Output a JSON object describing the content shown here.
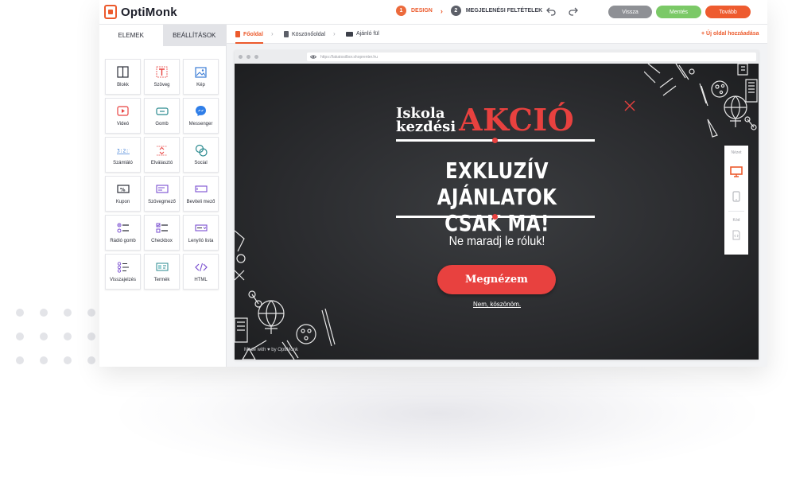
{
  "app": {
    "logo_text": "OptiMonk",
    "brand_color": "#ec5a2c"
  },
  "steps": [
    {
      "num": "1",
      "label": "DESIGN",
      "active": true
    },
    {
      "num": "2",
      "label": "MEGJELENÉSI FELTÉTELEK",
      "active": false
    }
  ],
  "toolbar": {
    "back_label": "Vissza",
    "save_label": "Mentés",
    "next_label": "Tovább",
    "undo_icon": "undo-icon",
    "redo_icon": "redo-icon"
  },
  "sidebar": {
    "tabs": [
      {
        "label": "ELEMEK",
        "active": true
      },
      {
        "label": "BEÁLLÍTÁSOK",
        "active": false
      }
    ],
    "elements": [
      {
        "label": "Blokk",
        "icon": "block-icon"
      },
      {
        "label": "Szöveg",
        "icon": "text-icon"
      },
      {
        "label": "Kép",
        "icon": "image-icon"
      },
      {
        "label": "Videó",
        "icon": "video-icon"
      },
      {
        "label": "Gomb",
        "icon": "button-icon"
      },
      {
        "label": "Messenger",
        "icon": "messenger-icon"
      },
      {
        "label": "Számláló",
        "icon": "counter-icon"
      },
      {
        "label": "Elválasztó",
        "icon": "divider-icon"
      },
      {
        "label": "Social",
        "icon": "social-icon"
      },
      {
        "label": "Kupon",
        "icon": "coupon-icon"
      },
      {
        "label": "Szövegmező",
        "icon": "textarea-icon"
      },
      {
        "label": "Beviteli mező",
        "icon": "input-field-icon"
      },
      {
        "label": "Rádió gomb",
        "icon": "radio-icon"
      },
      {
        "label": "Checkbox",
        "icon": "checkbox-icon"
      },
      {
        "label": "Lenyíló lista",
        "icon": "dropdown-icon"
      },
      {
        "label": "Visszajelzés",
        "icon": "feedback-icon"
      },
      {
        "label": "Termék",
        "icon": "product-icon"
      },
      {
        "label": "HTML",
        "icon": "html-icon"
      }
    ]
  },
  "page_tabs": [
    {
      "label": "Főoldal",
      "active": true
    },
    {
      "label": "Köszönőoldal",
      "active": false
    },
    {
      "label": "Ajánló fül",
      "active": false
    }
  ],
  "add_page_label": "+ Új oldal hozzáadása",
  "browser": {
    "url": "https://lakatosilbor.shoprenter.hu"
  },
  "popup": {
    "headline_small_line1": "Iskola",
    "headline_small_line2": "kezdési",
    "headline_big": "AKCIÓ",
    "exclusive_line1": "EXKLUZÍV AJÁNLATOK",
    "exclusive_line2": "CSAK MA!",
    "subheadline": "Ne maradj le róluk!",
    "cta_label": "Megnézem",
    "decline_label": "Nem, köszönöm.",
    "footer": "Made with ♥ by OptiMonk",
    "accent_color": "#e8413f"
  },
  "view_panel": {
    "view_label": "Nézet",
    "code_label": "Kód"
  }
}
